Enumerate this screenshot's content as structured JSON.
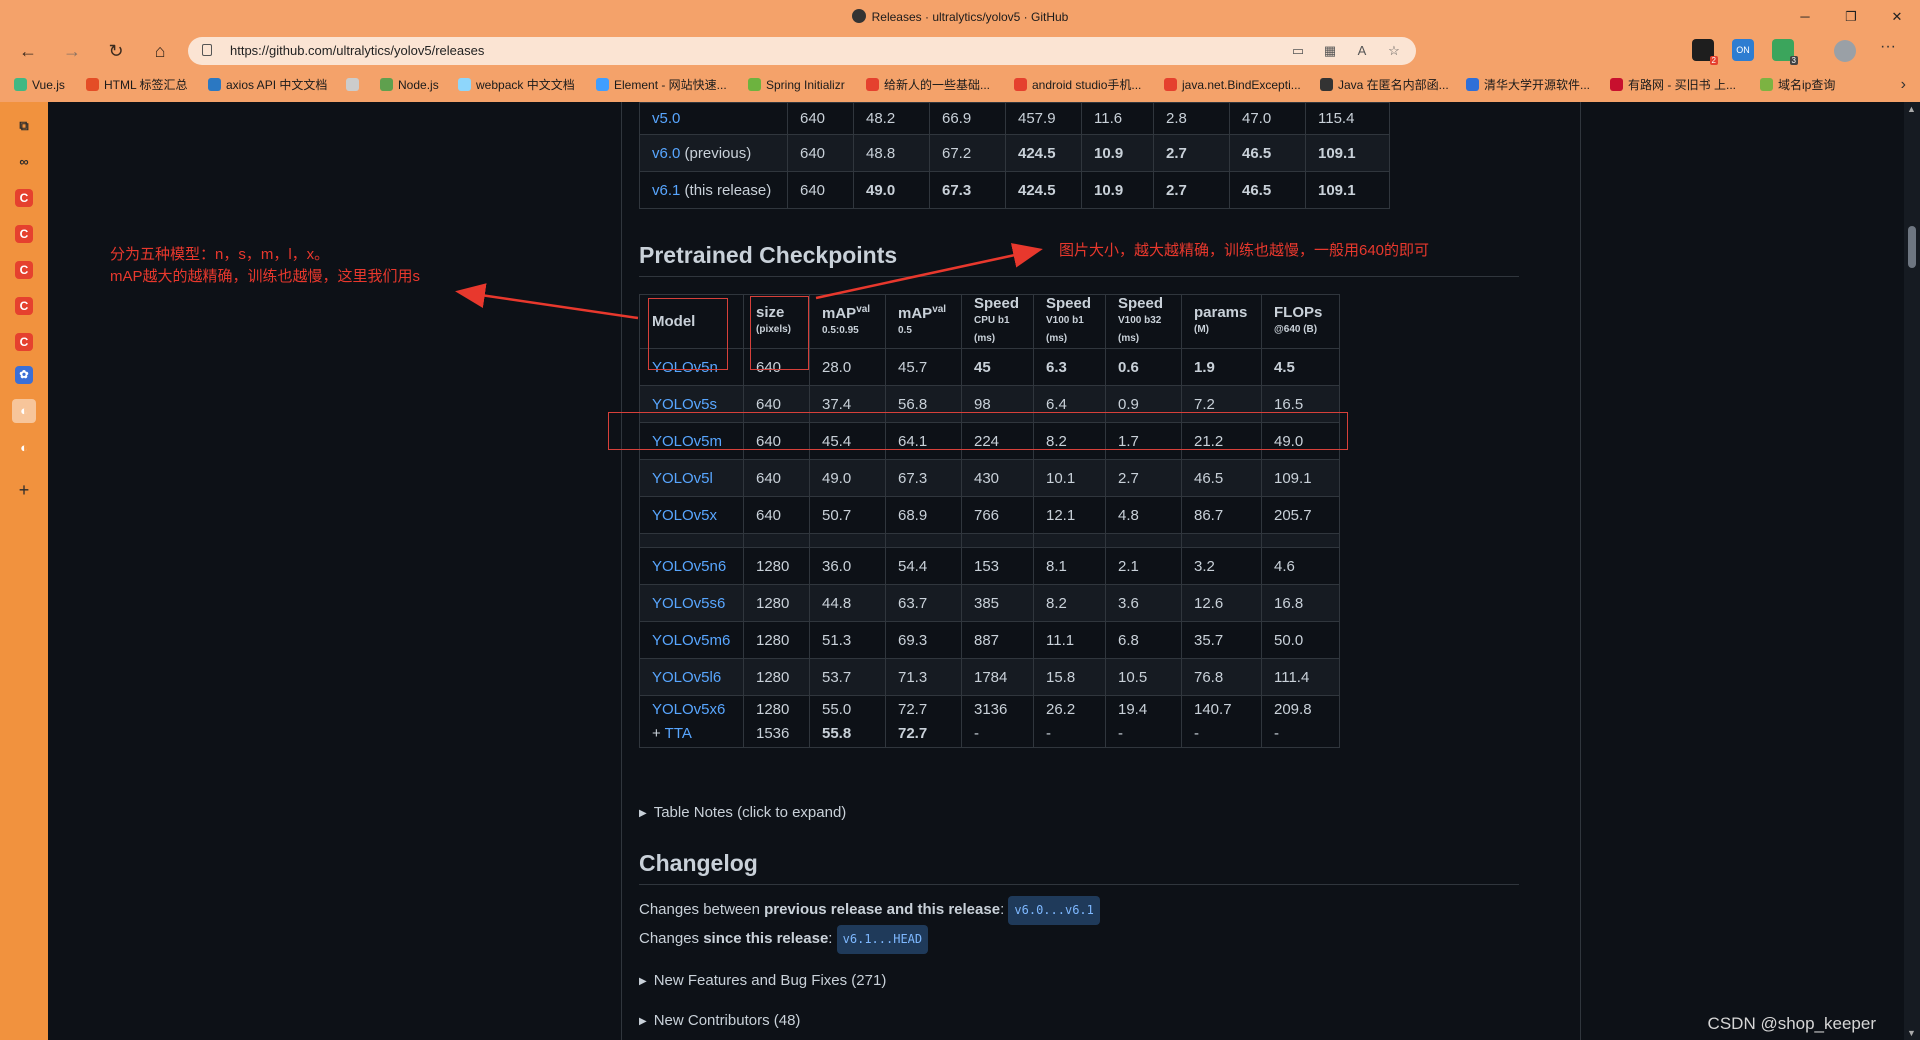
{
  "window": {
    "title": "Releases · ultralytics/yolov5 · GitHub",
    "controls": [
      "─",
      "❐",
      "✕"
    ]
  },
  "nav": {
    "back": "←",
    "forward": "→",
    "reload": "↻",
    "home": "⌂",
    "url": "https://github.com/ultralytics/yolov5/releases",
    "ext_badges": {
      "ext1": "2",
      "ext2": "ON",
      "ext3": "3"
    }
  },
  "bookmarks": [
    {
      "label": "Vue.js",
      "color": "#41b883"
    },
    {
      "label": "HTML 标签汇总",
      "color": "#e44d26"
    },
    {
      "label": "axios API 中文文档",
      "color": "#2b78c2"
    },
    {
      "label": "",
      "color": "#cccccc"
    },
    {
      "label": "Node.js",
      "color": "#5fa04e"
    },
    {
      "label": "webpack 中文文档",
      "color": "#8ed6fb"
    },
    {
      "label": "Element - 网站快速...",
      "color": "#409eff"
    },
    {
      "label": "Spring Initializr",
      "color": "#6db33f"
    },
    {
      "label": "给新人的一些基础...",
      "color": "#e5412e"
    },
    {
      "label": "android studio手机...",
      "color": "#e5412e"
    },
    {
      "label": "java.net.BindExcepti...",
      "color": "#e5412e"
    },
    {
      "label": "Java 在匿名内部函...",
      "color": "#333333"
    },
    {
      "label": "清华大学开源软件...",
      "color": "#2f6fd8"
    },
    {
      "label": "有路网 - 买旧书 上...",
      "color": "#c8102e"
    },
    {
      "label": "域名ip查询",
      "color": "#7cb342"
    }
  ],
  "sidebar": {
    "icons": [
      "⧉",
      "∞",
      "C",
      "C",
      "C",
      "C",
      "C",
      "✿",
      "◐",
      "◐",
      "+"
    ]
  },
  "top_table": {
    "rows": [
      {
        "model": "v5.0",
        "note": "",
        "size": "640",
        "map95": "48.2",
        "map5": "66.9",
        "speed_cpu": "457.9",
        "speed_v100": "11.6",
        "speed_b32": "2.8",
        "params": "47.0",
        "flops": "115.4",
        "bold": false
      },
      {
        "model": "v6.0",
        "note": " (previous)",
        "size": "640",
        "map95": "48.8",
        "map5": "67.2",
        "speed_cpu": "424.5",
        "speed_v100": "10.9",
        "speed_b32": "2.7",
        "params": "46.5",
        "flops": "109.1",
        "bold": true
      },
      {
        "model": "v6.1",
        "note": " (this release)",
        "size": "640",
        "map95": "49.0",
        "map5": "67.3",
        "speed_cpu": "424.5",
        "speed_v100": "10.9",
        "speed_b32": "2.7",
        "params": "46.5",
        "flops": "109.1",
        "bold": true
      }
    ]
  },
  "checkpoints": {
    "heading": "Pretrained Checkpoints",
    "headers": {
      "model": "Model",
      "size": "size",
      "size_sub": "(pixels)",
      "map1": "mAP",
      "map1_sup": "val",
      "map1_sub": "0.5:0.95",
      "map2": "mAP",
      "map2_sup": "val",
      "map2_sub": "0.5",
      "speed1": "Speed",
      "speed1_sub": "CPU b1",
      "speed1_unit": "(ms)",
      "speed2": "Speed",
      "speed2_sub": "V100 b1",
      "speed2_unit": "(ms)",
      "speed3": "Speed",
      "speed3_sub": "V100 b32",
      "speed3_unit": "(ms)",
      "params": "params",
      "params_sub": "(M)",
      "flops": "FLOPs",
      "flops_sub": "@640 (B)"
    },
    "group1": [
      {
        "model": "YOLOv5n",
        "size": "640",
        "map95": "28.0",
        "map5": "45.7",
        "cpu": "45",
        "v100": "6.3",
        "b32": "0.6",
        "params": "1.9",
        "flops": "4.5"
      },
      {
        "model": "YOLOv5s",
        "size": "640",
        "map95": "37.4",
        "map5": "56.8",
        "cpu": "98",
        "v100": "6.4",
        "b32": "0.9",
        "params": "7.2",
        "flops": "16.5"
      },
      {
        "model": "YOLOv5m",
        "size": "640",
        "map95": "45.4",
        "map5": "64.1",
        "cpu": "224",
        "v100": "8.2",
        "b32": "1.7",
        "params": "21.2",
        "flops": "49.0"
      },
      {
        "model": "YOLOv5l",
        "size": "640",
        "map95": "49.0",
        "map5": "67.3",
        "cpu": "430",
        "v100": "10.1",
        "b32": "2.7",
        "params": "46.5",
        "flops": "109.1"
      },
      {
        "model": "YOLOv5x",
        "size": "640",
        "map95": "50.7",
        "map5": "68.9",
        "cpu": "766",
        "v100": "12.1",
        "b32": "4.8",
        "params": "86.7",
        "flops": "205.7"
      }
    ],
    "group2": [
      {
        "model": "YOLOv5n6",
        "size": "1280",
        "map95": "36.0",
        "map5": "54.4",
        "cpu": "153",
        "v100": "8.1",
        "b32": "2.1",
        "params": "3.2",
        "flops": "4.6"
      },
      {
        "model": "YOLOv5s6",
        "size": "1280",
        "map95": "44.8",
        "map5": "63.7",
        "cpu": "385",
        "v100": "8.2",
        "b32": "3.6",
        "params": "12.6",
        "flops": "16.8"
      },
      {
        "model": "YOLOv5m6",
        "size": "1280",
        "map95": "51.3",
        "map5": "69.3",
        "cpu": "887",
        "v100": "11.1",
        "b32": "6.8",
        "params": "35.7",
        "flops": "50.0"
      },
      {
        "model": "YOLOv5l6",
        "size": "1280",
        "map95": "53.7",
        "map5": "71.3",
        "cpu": "1784",
        "v100": "15.8",
        "b32": "10.5",
        "params": "76.8",
        "flops": "111.4"
      }
    ],
    "last_row": {
      "model": "YOLOv5x6",
      "tta_prefix": "+ ",
      "tta": "TTA",
      "size": "1280",
      "size2": "1536",
      "map95": "55.0",
      "map95_2": "55.8",
      "map5": "72.7",
      "map5_2": "72.7",
      "cpu": "3136",
      "cpu2": "-",
      "v100": "26.2",
      "v100_2": "-",
      "b32": "19.4",
      "b32_2": "-",
      "params": "140.7",
      "params2": "-",
      "flops": "209.8",
      "flops2": "-"
    },
    "notes": "Table Notes (click to expand)"
  },
  "changelog": {
    "heading": "Changelog",
    "line1_a": "Changes between ",
    "line1_b": "previous release and this release",
    "line1_c": ": ",
    "line1_code": "v6.0...v6.1",
    "line2_a": "Changes ",
    "line2_b": "since this release",
    "line2_c": ": ",
    "line2_code": "v6.1...HEAD",
    "features": "New Features and Bug Fixes (271)",
    "contributors": "New Contributors (48)"
  },
  "annotations": {
    "left_line1": "分为五种模型：n，s，m，l，x。",
    "left_line2": "mAP越大的越精确，训练也越慢，这里我们用s",
    "right": "图片大小，越大越精确，训练也越慢，一般用640的即可",
    "color": "#e8382d"
  },
  "watermark": "CSDN @shop_keeper"
}
